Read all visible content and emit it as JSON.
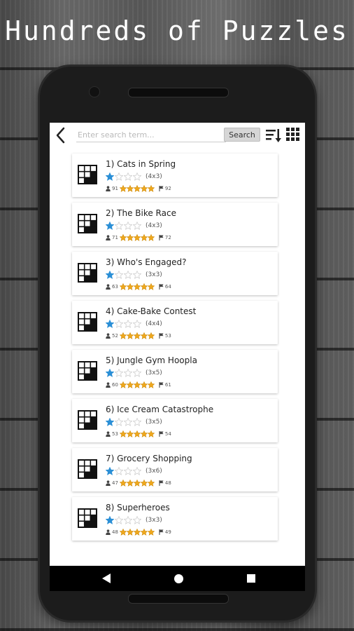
{
  "headline": "Hundreds of Puzzles",
  "search": {
    "placeholder": "Enter search term...",
    "button_label": "Search"
  },
  "icons": {
    "back": "chevron-left-icon",
    "sort": "sort-descending-icon",
    "grid": "grid-view-icon",
    "difficulty": "blue-star-icon",
    "rating": "gold-star-icon",
    "plays": "person-icon",
    "flag": "flag-icon"
  },
  "colors": {
    "difficulty_star": "#2b8fd6",
    "rating_star": "#f0a81c",
    "empty_star": "#cfcfcf"
  },
  "puzzles": [
    {
      "title": "1) Cats in Spring",
      "size": "(4x3)",
      "difficulty": 1,
      "plays": "91",
      "rating": 5,
      "flags": "92"
    },
    {
      "title": "2) The Bike Race",
      "size": "(4x3)",
      "difficulty": 1,
      "plays": "71",
      "rating": 5,
      "flags": "72"
    },
    {
      "title": "3) Who's Engaged?",
      "size": "(3x3)",
      "difficulty": 1,
      "plays": "63",
      "rating": 5,
      "flags": "64"
    },
    {
      "title": "4) Cake-Bake Contest",
      "size": "(4x4)",
      "difficulty": 1,
      "plays": "52",
      "rating": 5,
      "flags": "53"
    },
    {
      "title": "5) Jungle Gym Hoopla",
      "size": "(3x5)",
      "difficulty": 1,
      "plays": "60",
      "rating": 5,
      "flags": "61"
    },
    {
      "title": "6) Ice Cream Catastrophe",
      "size": "(3x5)",
      "difficulty": 1,
      "plays": "53",
      "rating": 5,
      "flags": "54"
    },
    {
      "title": "7) Grocery Shopping",
      "size": "(3x6)",
      "difficulty": 1,
      "plays": "47",
      "rating": 5,
      "flags": "48"
    },
    {
      "title": "8) Superheroes",
      "size": "(3x3)",
      "difficulty": 1,
      "plays": "48",
      "rating": 5,
      "flags": "49"
    }
  ]
}
